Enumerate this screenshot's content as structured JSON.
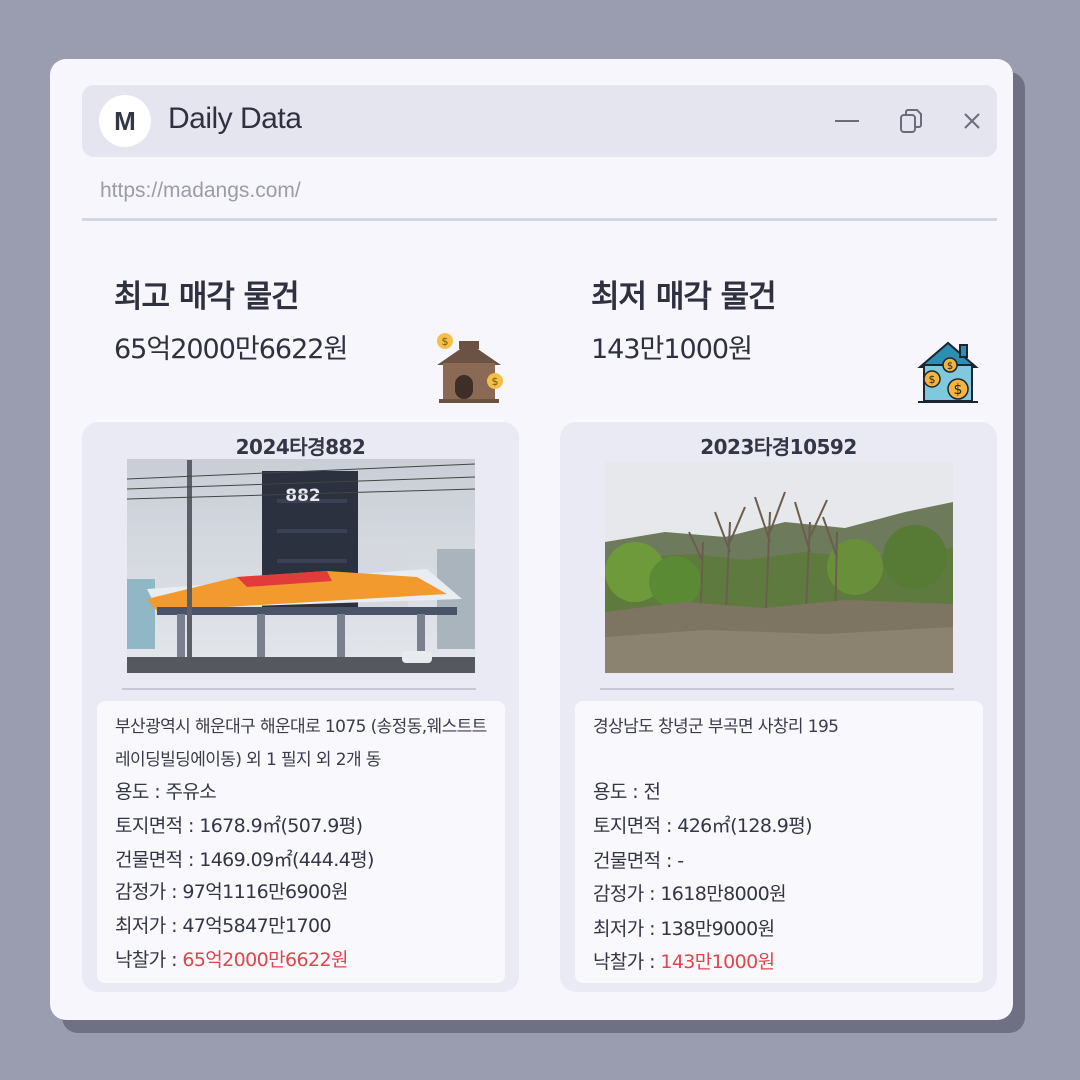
{
  "window": {
    "logo_letter": "M",
    "title": "Daily Data",
    "url": "https://madangs.com/"
  },
  "highest": {
    "heading": "최고 매각 물건",
    "amount": "65억2000만6622원",
    "case_no": "2024타경882",
    "photo_sign": "882",
    "address": "부산광역시 해운대구 해운대로 1075 (송정동,웨스트트레이딩빌딩에이동) 외 1 필지 외 2개 동",
    "usage": "용도 : 주유소",
    "land_area": "토지면적 : 1678.9㎡(507.9평)",
    "building_area": "건물면적 : 1469.09㎡(444.4평)",
    "appraisal": "감정가 : 97억1116만6900원",
    "minimum": "최저가 : 47억5847만1700",
    "winning_label": "낙찰가 : ",
    "winning_value": "65억2000만6622원"
  },
  "lowest": {
    "heading": "최저 매각 물건",
    "amount": "143만1000원",
    "case_no": "2023타경10592",
    "address": "경상남도 창녕군 부곡면 사창리 195",
    "usage": "용도 : 전",
    "land_area": "토지면적 : 426㎡(128.9평)",
    "building_area": "건물면적 : -",
    "appraisal": "감정가 : 1618만8000원",
    "minimum": "최저가 : 138만9000원",
    "winning_label": "낙찰가 : ",
    "winning_value": "143만1000원"
  },
  "colors": {
    "background": "#9a9caf",
    "panel": "#f6f6fc",
    "card": "#e9eaf3",
    "accent_red": "#e0464b"
  },
  "icons": [
    "minimize-icon",
    "restore-icon",
    "close-icon",
    "house-coin-icon",
    "house-money-icon"
  ]
}
